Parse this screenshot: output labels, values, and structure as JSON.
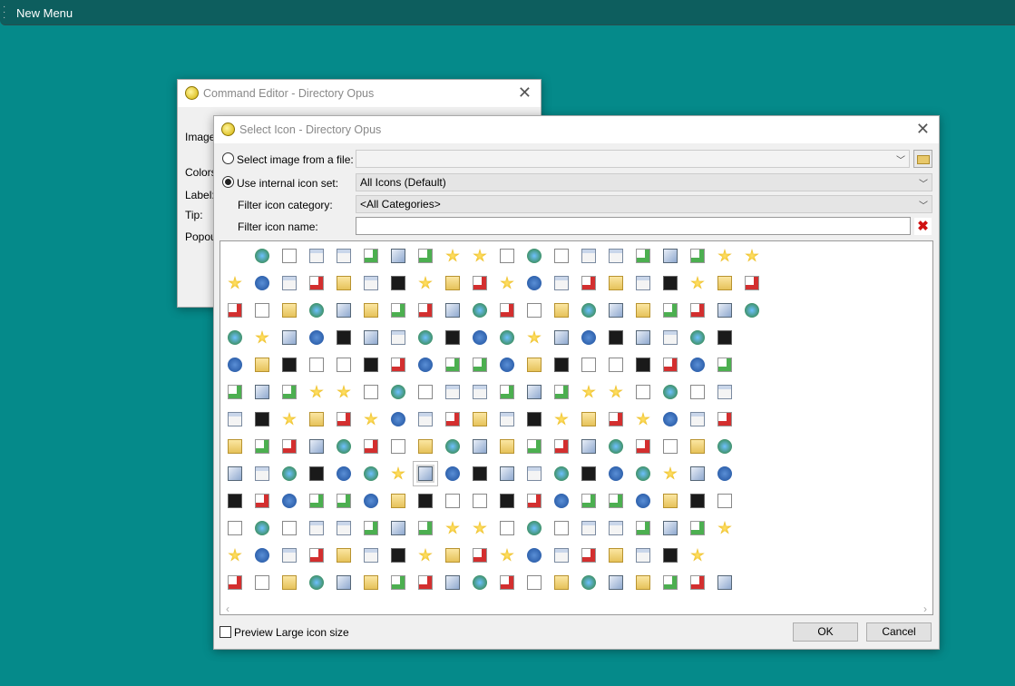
{
  "taskbar": {
    "title": "New Menu"
  },
  "command_editor": {
    "title": "Command Editor - Directory Opus",
    "labels": [
      "Image",
      "Colors",
      "Label:",
      "Tip:",
      "Popou"
    ]
  },
  "select_icon": {
    "title": "Select Icon - Directory Opus",
    "file_option": "Select image from a file:",
    "file_value": "",
    "internal_option": "Use internal icon set:",
    "internal_selected": true,
    "icon_set": "All Icons (Default)",
    "category_label": "Filter icon category:",
    "category": "<All Categories>",
    "name_label": "Filter icon name:",
    "name_value": "",
    "preview_label": "Preview Large icon size",
    "preview_checked": false,
    "ok": "OK",
    "cancel": "Cancel",
    "icon_rows": [
      20,
      20,
      20,
      19,
      19,
      19,
      19,
      19,
      19,
      19,
      19,
      18,
      19
    ],
    "selected_icon": {
      "row": 9,
      "col": 8
    }
  }
}
